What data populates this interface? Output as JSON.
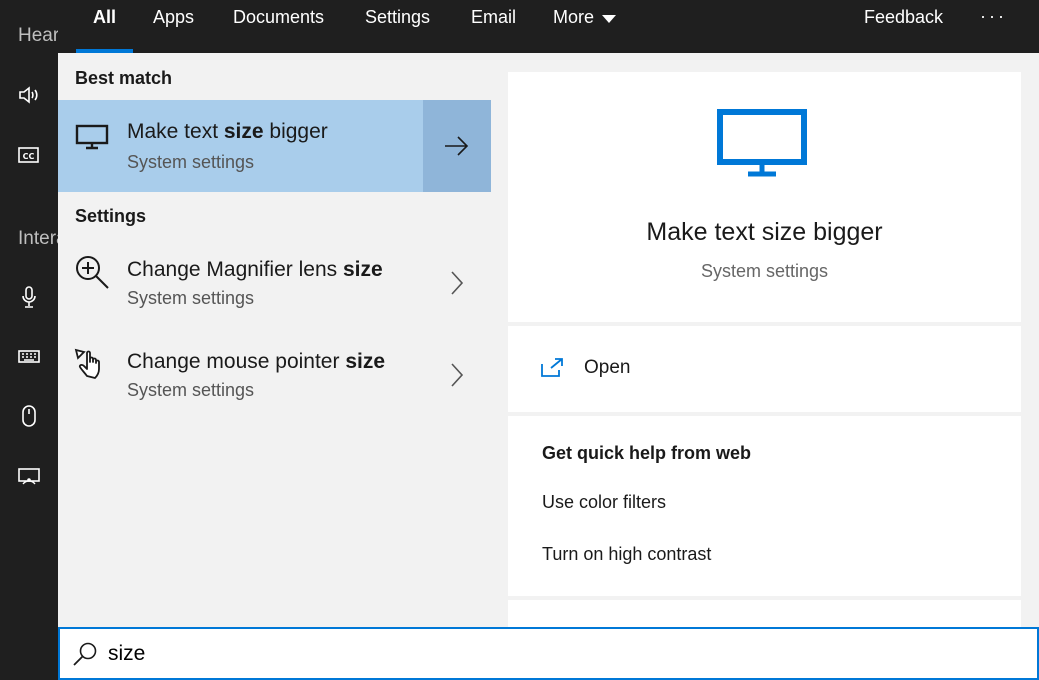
{
  "rail": {
    "section1": "Hearing",
    "section2": "Interaction",
    "icons": [
      "speaker-icon",
      "closed-captions-icon",
      "microphone-icon",
      "keyboard-icon",
      "mouse-icon",
      "eye-control-icon"
    ]
  },
  "tabs": {
    "items": [
      "All",
      "Apps",
      "Documents",
      "Settings",
      "Email",
      "More"
    ],
    "active": "All",
    "feedback": "Feedback",
    "more_options": "···"
  },
  "results": {
    "best_match_heading": "Best match",
    "best_match": {
      "title_pre": "Make text ",
      "title_bold": "size",
      "title_post": " bigger",
      "subtitle": "System settings",
      "icon": "monitor-icon"
    },
    "settings_heading": "Settings",
    "settings": [
      {
        "title_pre": "Change Magnifier lens ",
        "title_bold": "size",
        "subtitle": "System settings",
        "icon": "magnifier-icon"
      },
      {
        "title_pre": "Change mouse pointer ",
        "title_bold": "size",
        "subtitle": "System settings",
        "icon": "hand-pointer-icon"
      }
    ]
  },
  "preview": {
    "title": "Make text size bigger",
    "subtitle": "System settings",
    "open_label": "Open",
    "web_heading": "Get quick help from web",
    "web_links": [
      "Use color filters",
      "Turn on high contrast"
    ]
  },
  "search": {
    "value": "size",
    "icon": "search-icon"
  },
  "colors": {
    "accent": "#0078d7",
    "selected_bg": "#a9cdeb",
    "selected_arrow_bg": "#8fb5d9",
    "dark_bg": "#1f1f1f"
  }
}
